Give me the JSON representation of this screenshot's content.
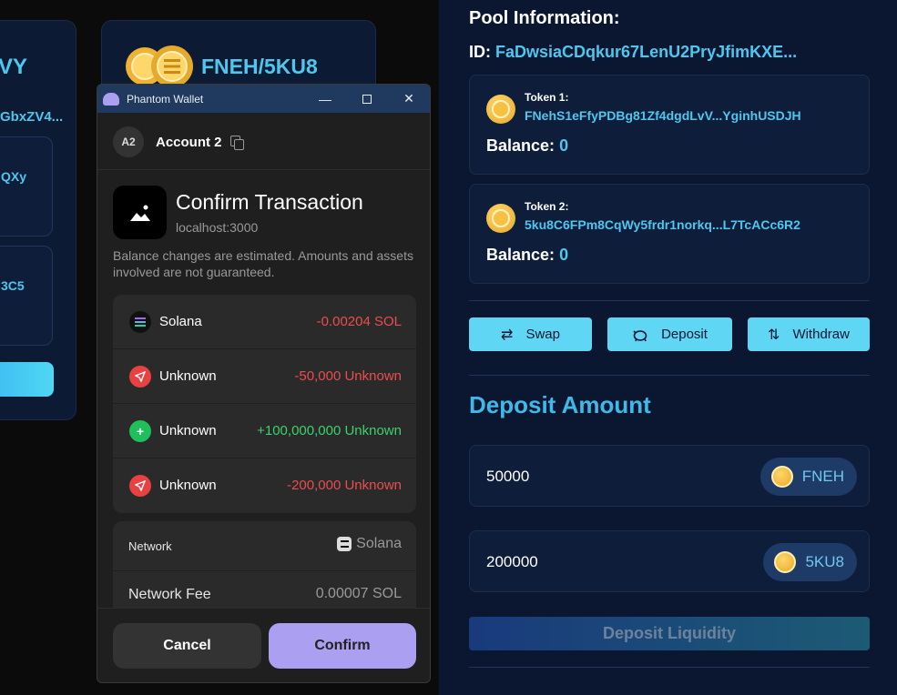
{
  "background": {
    "left_card_title": "VY",
    "left_card_sub": "GbxZV4...",
    "left_inner1_text": "QXy",
    "left_inner2_text": "3C5",
    "pair_title": "FNEH/5KU8"
  },
  "pool": {
    "heading": "Pool Information:",
    "id_label": "ID:",
    "id_value": "FaDwsiaCDqkur67LenU2PryJfimKXE...",
    "tokens": [
      {
        "label": "Token 1:",
        "address": "FNehS1eFfyPDBg81Zf4dgdLvV...YginhUSDJH",
        "balance_label": "Balance:",
        "balance": "0"
      },
      {
        "label": "Token 2:",
        "address": "5ku8C6FPm8CqWy5frdr1norkq...L7TcACc6R2",
        "balance_label": "Balance:",
        "balance": "0"
      }
    ],
    "actions": {
      "swap": "Swap",
      "deposit": "Deposit",
      "withdraw": "Withdraw"
    },
    "deposit_heading": "Deposit Amount",
    "amounts": [
      {
        "value": "50000",
        "token": "FNEH"
      },
      {
        "value": "200000",
        "token": "5KU8"
      }
    ],
    "deposit_button": "Deposit Liquidity"
  },
  "wallet": {
    "window_title": "Phantom Wallet",
    "account_badge": "A2",
    "account_name": "Account 2",
    "title": "Confirm Transaction",
    "origin": "localhost:3000",
    "note": "Balance changes are estimated. Amounts and assets involved are not guaranteed.",
    "changes": [
      {
        "name": "Solana",
        "amount": "-0.00204 SOL",
        "kind": "neg",
        "icon": "solana-icon"
      },
      {
        "name": "Unknown",
        "amount": "-50,000 Unknown",
        "kind": "neg",
        "icon": "send-icon"
      },
      {
        "name": "Unknown",
        "amount": "+100,000,000 Unknown",
        "kind": "pos",
        "icon": "plus-icon"
      },
      {
        "name": "Unknown",
        "amount": "-200,000 Unknown",
        "kind": "neg",
        "icon": "send-icon"
      }
    ],
    "network_label": "Network",
    "network_value": "Solana",
    "fee_label": "Network Fee",
    "fee_value": "0.00007 SOL",
    "cancel": "Cancel",
    "confirm": "Confirm"
  },
  "colors": {
    "accent": "#4ec6ee",
    "phantom_purple": "#ab9ff2",
    "negative": "#ea4d4d",
    "positive": "#3bd26b"
  }
}
